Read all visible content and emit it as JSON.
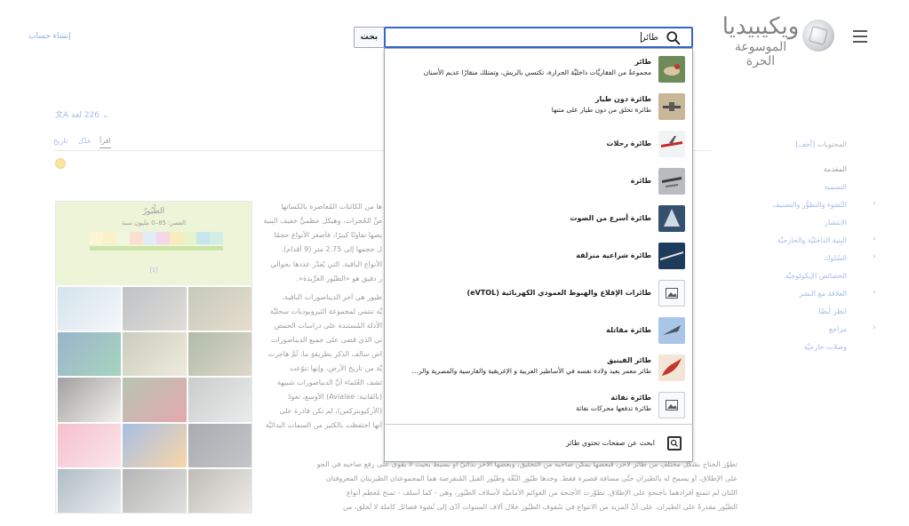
{
  "header": {
    "wordmark_title": "ويكيبيديا",
    "wordmark_tagline": "الموسوعة الحرة",
    "create_account": "إنشاء حساب"
  },
  "search": {
    "value": "طائر",
    "button_label": "بحث",
    "suggestions": [
      {
        "title": "طائر",
        "description": "مجموعةٌ من الفقاريَّات داخليَّة الحرارة، تكتسي بالريش، وتمتلك منقارًا عديم الأسنان",
        "thumb": "bird-thumb"
      },
      {
        "title": "طائرة دون طيار",
        "description": "طائرة تحلق من دون طيار على متنها",
        "thumb": "drone-thumb"
      },
      {
        "title": "طائرة رحلات",
        "description": "",
        "thumb": "airliner-thumb"
      },
      {
        "title": "طائرة",
        "description": "",
        "thumb": "aircraft-thumb"
      },
      {
        "title": "طائرة أسرع من الصوت",
        "description": "",
        "thumb": "supersonic-thumb"
      },
      {
        "title": "طائرة شراعية منزلقة",
        "description": "",
        "thumb": "hangglider-thumb"
      },
      {
        "title": "طائرات الإقلاع والهبوط العمودي الكهربائية (eVTOL)",
        "description": "",
        "thumb": "image-placeholder-icon"
      },
      {
        "title": "طائرة مقاتلة",
        "description": "",
        "thumb": "fighter-thumb"
      },
      {
        "title": "طائر الفينيق",
        "description": "طائر معمر يعيد ولادة نفسه في الأساطير العربية و الإغريقية والفارسية والمصرية والر…",
        "thumb": "phoenix-thumb"
      },
      {
        "title": "طائرة نفاثة",
        "description": "طائرة تدفعها محركات نفاثة",
        "thumb": "image-placeholder-icon"
      }
    ],
    "fulltext_label": "ابحث عن صفحات تحتوي طائر"
  },
  "toc": {
    "title": "المحتويات",
    "hide": "[أخف]",
    "items": [
      {
        "label": "المقدمة",
        "plain": true,
        "chevron": false
      },
      {
        "label": "التسمية",
        "plain": false,
        "chevron": false
      },
      {
        "label": "النُشوء والتطوُّر والتصنيف",
        "plain": false,
        "chevron": true
      },
      {
        "label": "الانتشار",
        "plain": false,
        "chevron": false
      },
      {
        "label": "البِنية الداخليَّة والخارجيَّة",
        "plain": false,
        "chevron": true
      },
      {
        "label": "السُلوك",
        "plain": false,
        "chevron": true
      },
      {
        "label": "الخصائص الإيكولوجيَّة",
        "plain": false,
        "chevron": false
      },
      {
        "label": "العلاقة مع البشر",
        "plain": false,
        "chevron": true
      },
      {
        "label": "انظر أيضًا",
        "plain": false,
        "chevron": false
      },
      {
        "label": "مراجع",
        "plain": false,
        "chevron": true
      },
      {
        "label": "وصلات خارجيَّة",
        "plain": false,
        "chevron": false
      }
    ]
  },
  "article": {
    "languages": "226 لغة",
    "tabs": {
      "read": "اقرأ",
      "edit": "عدّل",
      "history": "تاريخ"
    },
    "infobox": {
      "title": "الطُيُورُ",
      "era": "العصر: 85–0 مليون سنة",
      "link": "[1]"
    },
    "lines": [
      "ها من الكائنات المُعاصرة بالكساتها",
      "صِّ الحُجرات، وهيكل عظميٌّ خفيف البِنية",
      "يضها تفاوتًا كبيرًا، فأصغر الأنواع حجمًا",
      "ل حجمها إلى 2.75 متر (9 أقدام).",
      "الأنواع الباقية، التي يُقدّر عددها بحوالي",
      "ر دقيق هو «الطُيُور الغرِّيدة».",
      "طيور هي آخر الديناصورات الباقية،",
      "يَّة تنتمي لمجموعة الثيروبوديات سحليَّة",
      "الأدلَّة المُستندة على دراسات الحمض",
      "تي الذي قضى على جميع الديناصورات",
      "اض سالف الذكر بطريقةٍ ما، ثُمَّ هاجرت",
      "يَّة من تاريخ الأرض، وإنها تنوّعت",
      "تشف العُلماء أنَّ الديناصورات شبيهة",
      "(بالقانية: Avialae) الأوسع، تعودُ",
      "(الأركيوبتركس)، لم تكن قادرة على",
      "أنها احتفظت بالكثير من السمات البدائيَّة",
      "تطوّر الجناح بشكلٍ مختلفٍ من طائر لآخر، فبعضها يمكِّن صاحبه من التحليق، وبعضها الآخر بدائيٌّ أو بسيط بحيث لا يقوى على رفع صاحبه في الجو",
      "على الإطلاق، أو يسمح له بالطيران حتّى مسافة قصيرة فقط. وجدها طُيُور النُّعَّة وطُيُور الفيل المُنقرضة هما المجموعتان الطيريتان المعروفتان",
      "اللتان لم تتمتع أفرادهما بأجنحةٍ على الإطلاق. تطوَّرت الأجنحة من القوائم الأماميَّة لأسلاف الطُيُور، وهي - كما أسلف - تمنح مُعظم أنواع",
      "الطُيُور مقدرةً على الطيران، على أنَّ المزيد من الانتواع في سُفوف الطُيُور خلال آلاف السنوات أدّى إلى نُشوء فصائل كاملة لا تُحلِّق، من"
    ]
  },
  "colors": {
    "link": "#3366cc",
    "text": "#202122",
    "border": "#a2a9b1",
    "infobox_header": "#d9e6a6"
  }
}
